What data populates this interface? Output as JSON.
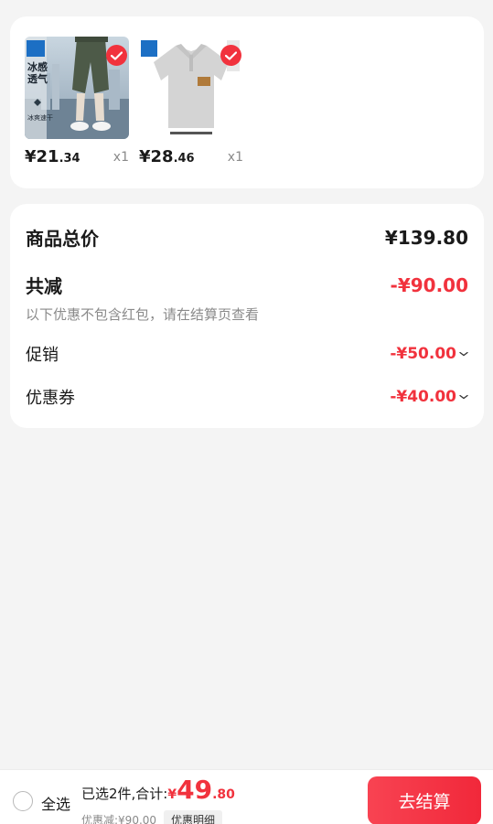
{
  "products": [
    {
      "image_text_main": "冰感透气",
      "image_text_sub": "冰爽速干",
      "price_int": "¥21",
      "price_dec": ".34",
      "qty": "x1",
      "selected": true
    },
    {
      "price_int": "¥28",
      "price_dec": ".46",
      "qty": "x1",
      "selected": true
    }
  ],
  "summary": {
    "total_label": "商品总价",
    "total_value": "¥139.80",
    "reduce_label": "共减",
    "reduce_value": "-¥90.00",
    "note": "以下优惠不包含红包，请在结算页查看",
    "promo_label": "促销",
    "promo_value": "-¥50.00",
    "coupon_label": "优惠券",
    "coupon_value": "-¥40.00"
  },
  "bottom": {
    "select_all": "全选",
    "selected_text": "已选2件,合计:",
    "currency": "¥",
    "total_int": "49",
    "total_dec": ".80",
    "discount_text": "优惠减:¥90.00",
    "detail_label": "优惠明细",
    "checkout_label": "去结算"
  },
  "colors": {
    "accent": "#f1323d",
    "background": "#f4f4f4",
    "muted": "#8a8a8a"
  }
}
